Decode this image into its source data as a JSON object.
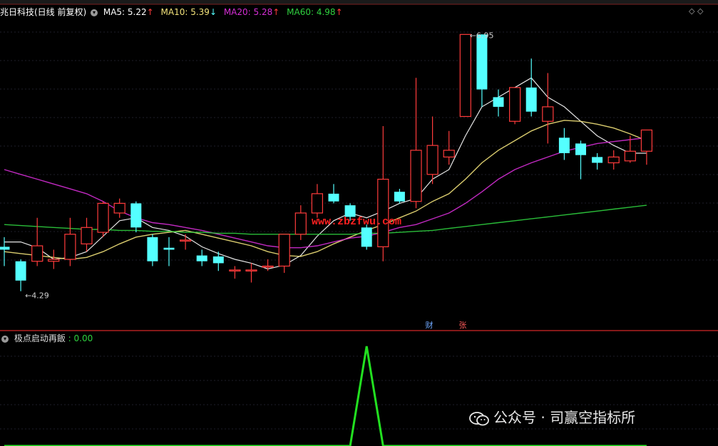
{
  "header": {
    "stock_name": "兆日科技(日线 前复权)",
    "ma5": {
      "label": "MA5: 5.22",
      "arrow": "↑",
      "color": "#ffffff"
    },
    "ma10": {
      "label": "MA10: 5.39",
      "arrow": "↓",
      "color": "#f2e27a"
    },
    "ma20": {
      "label": "MA20: 5.28",
      "arrow": "↑",
      "color": "#d62ed6"
    },
    "ma60": {
      "label": "MA60: 4.98",
      "arrow": "↑",
      "color": "#2fd13f"
    }
  },
  "sub_header": {
    "label": "极点启动再飯",
    "value": ": 0.00"
  },
  "badges": {
    "cai": "财",
    "zhang": "张"
  },
  "website": "www.zbzfwu.com",
  "watermark": "公众号 · 司赢空指标所",
  "colors": {
    "up": "#ff3b3b",
    "down": "#54ffff",
    "indicator": "#22e020"
  },
  "chart_data": {
    "type": "candlestick",
    "ylim": [
      4.0,
      7.1
    ],
    "annotations": [
      {
        "text": "4.29",
        "bar": 1,
        "price": 4.29,
        "kind": "low"
      },
      {
        "text": "6.95",
        "bar": 28,
        "price": 6.95,
        "kind": "high"
      }
    ],
    "candles": [
      {
        "o": 4.75,
        "c": 4.72,
        "h": 4.85,
        "l": 4.55
      },
      {
        "o": 4.6,
        "c": 4.4,
        "h": 4.62,
        "l": 4.29
      },
      {
        "o": 4.6,
        "c": 4.76,
        "h": 5.05,
        "l": 4.55
      },
      {
        "o": 4.6,
        "c": 4.62,
        "h": 4.72,
        "l": 4.52
      },
      {
        "o": 4.62,
        "c": 4.88,
        "h": 5.05,
        "l": 4.55
      },
      {
        "o": 4.78,
        "c": 4.95,
        "h": 5.05,
        "l": 4.7
      },
      {
        "o": 4.9,
        "c": 5.2,
        "h": 5.22,
        "l": 4.85
      },
      {
        "o": 5.1,
        "c": 5.2,
        "h": 5.25,
        "l": 5.05
      },
      {
        "o": 5.2,
        "c": 4.95,
        "h": 5.22,
        "l": 4.9
      },
      {
        "o": 4.85,
        "c": 4.6,
        "h": 4.88,
        "l": 4.55
      },
      {
        "o": 4.74,
        "c": 4.72,
        "h": 4.85,
        "l": 4.55
      },
      {
        "o": 4.82,
        "c": 4.82,
        "h": 4.88,
        "l": 4.72
      },
      {
        "o": 4.66,
        "c": 4.6,
        "h": 4.72,
        "l": 4.55
      },
      {
        "o": 4.65,
        "c": 4.58,
        "h": 4.7,
        "l": 4.5
      },
      {
        "o": 4.51,
        "c": 4.51,
        "h": 4.55,
        "l": 4.42
      },
      {
        "o": 4.51,
        "c": 4.51,
        "h": 4.58,
        "l": 4.38
      },
      {
        "o": 4.55,
        "c": 4.55,
        "h": 4.62,
        "l": 4.5
      },
      {
        "o": 4.55,
        "c": 4.88,
        "h": 4.88,
        "l": 4.48
      },
      {
        "o": 4.88,
        "c": 5.1,
        "h": 5.18,
        "l": 4.82
      },
      {
        "o": 5.1,
        "c": 5.3,
        "h": 5.4,
        "l": 5.05
      },
      {
        "o": 5.3,
        "c": 5.22,
        "h": 5.4,
        "l": 5.2
      },
      {
        "o": 5.18,
        "c": 5.06,
        "h": 5.2,
        "l": 5.02
      },
      {
        "o": 4.95,
        "c": 4.75,
        "h": 4.98,
        "l": 4.72
      },
      {
        "o": 4.75,
        "c": 5.45,
        "h": 6.0,
        "l": 4.6
      },
      {
        "o": 5.32,
        "c": 5.22,
        "h": 5.35,
        "l": 5.2
      },
      {
        "o": 5.22,
        "c": 5.75,
        "h": 6.5,
        "l": 5.15
      },
      {
        "o": 5.5,
        "c": 5.8,
        "h": 6.1,
        "l": 5.4
      },
      {
        "o": 5.68,
        "c": 5.75,
        "h": 5.95,
        "l": 5.6
      },
      {
        "o": 6.1,
        "c": 6.95,
        "h": 6.95,
        "l": 6.1
      },
      {
        "o": 6.95,
        "c": 6.38,
        "h": 6.95,
        "l": 6.2
      },
      {
        "o": 6.3,
        "c": 6.2,
        "h": 6.38,
        "l": 6.1
      },
      {
        "o": 6.05,
        "c": 6.4,
        "h": 6.4,
        "l": 6.02
      },
      {
        "o": 6.4,
        "c": 6.15,
        "h": 6.7,
        "l": 6.1
      },
      {
        "o": 6.05,
        "c": 6.2,
        "h": 6.55,
        "l": 5.82
      },
      {
        "o": 5.88,
        "c": 5.72,
        "h": 5.98,
        "l": 5.65
      },
      {
        "o": 5.82,
        "c": 5.7,
        "h": 5.85,
        "l": 5.45
      },
      {
        "o": 5.68,
        "c": 5.62,
        "h": 5.72,
        "l": 5.55
      },
      {
        "o": 5.62,
        "c": 5.68,
        "h": 5.75,
        "l": 5.55
      },
      {
        "o": 5.64,
        "c": 5.74,
        "h": 5.9,
        "l": 5.62
      },
      {
        "o": 5.74,
        "c": 5.96,
        "h": 5.96,
        "l": 5.6
      }
    ],
    "ma_values": {
      "MA5": [
        4.8,
        4.8,
        4.74,
        4.62,
        4.64,
        4.7,
        4.86,
        5.02,
        5.05,
        4.95,
        4.92,
        4.86,
        4.75,
        4.68,
        4.62,
        4.58,
        4.52,
        4.56,
        4.66,
        4.86,
        5.02,
        5.1,
        5.05,
        5.12,
        5.2,
        5.25,
        5.45,
        5.55,
        5.9,
        6.2,
        6.3,
        6.4,
        6.5,
        6.3,
        6.2,
        6.05,
        5.9,
        5.8,
        5.72,
        5.72
      ],
      "MA10": [
        4.7,
        4.68,
        4.66,
        4.64,
        4.62,
        4.64,
        4.7,
        4.78,
        4.85,
        4.88,
        4.9,
        4.92,
        4.88,
        4.84,
        4.8,
        4.76,
        4.7,
        4.66,
        4.65,
        4.7,
        4.78,
        4.85,
        4.92,
        4.98,
        5.05,
        5.12,
        5.22,
        5.3,
        5.45,
        5.62,
        5.75,
        5.85,
        5.95,
        6.02,
        6.06,
        6.05,
        6.02,
        5.98,
        5.92,
        5.85
      ],
      "MA20": [
        5.55,
        5.5,
        5.45,
        5.4,
        5.35,
        5.3,
        5.22,
        5.12,
        5.05,
        5.0,
        4.98,
        4.95,
        4.92,
        4.88,
        4.84,
        4.8,
        4.76,
        4.74,
        4.74,
        4.76,
        4.8,
        4.84,
        4.86,
        4.9,
        4.95,
        4.98,
        5.04,
        5.1,
        5.2,
        5.32,
        5.45,
        5.55,
        5.62,
        5.68,
        5.74,
        5.78,
        5.82,
        5.84,
        5.86,
        5.88
      ],
      "MA60": [
        4.98,
        4.97,
        4.96,
        4.95,
        4.94,
        4.93,
        4.93,
        4.92,
        4.92,
        4.91,
        4.91,
        4.9,
        4.9,
        4.89,
        4.89,
        4.88,
        4.88,
        4.88,
        4.88,
        4.88,
        4.88,
        4.88,
        4.89,
        4.89,
        4.9,
        4.91,
        4.92,
        4.94,
        4.96,
        4.98,
        5.0,
        5.02,
        5.04,
        5.06,
        5.08,
        5.1,
        5.12,
        5.14,
        5.16,
        5.18
      ]
    },
    "indicator": {
      "series": [
        {
          "values": [
            0,
            0,
            0,
            0,
            0,
            0,
            0,
            0,
            0,
            0,
            0,
            0,
            0,
            0,
            0,
            0,
            0,
            0,
            0,
            0,
            0,
            0,
            1,
            0,
            0,
            0,
            0,
            0,
            0,
            0,
            0,
            0,
            0,
            0,
            0,
            0,
            0,
            0,
            0,
            0
          ]
        }
      ],
      "ylim": [
        0,
        1
      ],
      "peak_bar": 22
    }
  }
}
